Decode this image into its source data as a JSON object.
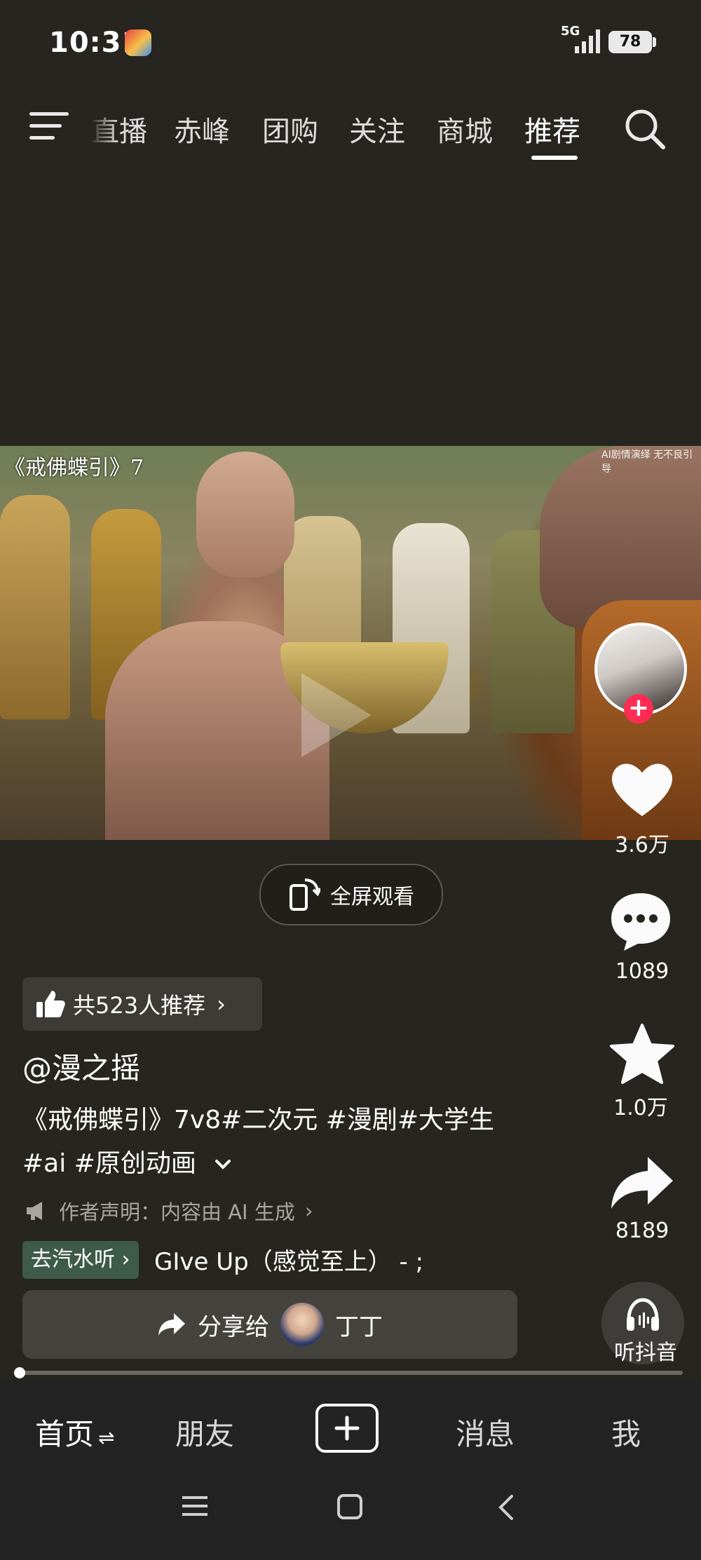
{
  "status_bar": {
    "time": "10:31",
    "network": "5G",
    "battery": "78",
    "app_badge_icon": "douyin-notification-icon"
  },
  "top_nav": {
    "tabs": [
      "直播",
      "赤峰",
      "团购",
      "关注",
      "商城",
      "推荐"
    ],
    "active_tab": "推荐",
    "menu_icon": "hamburger-menu-icon",
    "search_icon": "search-icon"
  },
  "video": {
    "title_overlay": "《戒佛蝶引》7",
    "ai_tag": "AI剧情演绎 无不良引导",
    "play_icon": "play-icon"
  },
  "right_rail": {
    "like_count": "3.6万",
    "comment_count": "1089",
    "favorite_count": "1.0万",
    "share_count": "8189",
    "listen_label": "听抖音"
  },
  "fullscreen": {
    "label": "全屏观看"
  },
  "caption": {
    "recommend": "共523人推荐",
    "author": "@漫之摇",
    "description_line1": "《戒佛蝶引》7v8#二次元 #漫剧#大学生",
    "description_line2": "#ai #原创动画",
    "declaration": "作者声明：内容由 AI 生成",
    "music_badge": "去汽水听",
    "music_title": "GIve Up（感觉至上） - ;",
    "share_label": "分享给",
    "share_friend": "丁丁"
  },
  "progress": {
    "played_fraction": 0.0
  },
  "bottom_nav": {
    "home": "首页",
    "friends": "朋友",
    "messages": "消息",
    "me": "我",
    "active": "首页"
  },
  "colors": {
    "background": "#27251f",
    "accent_red": "#fe2c55",
    "music_badge": "#3e5a4a"
  }
}
